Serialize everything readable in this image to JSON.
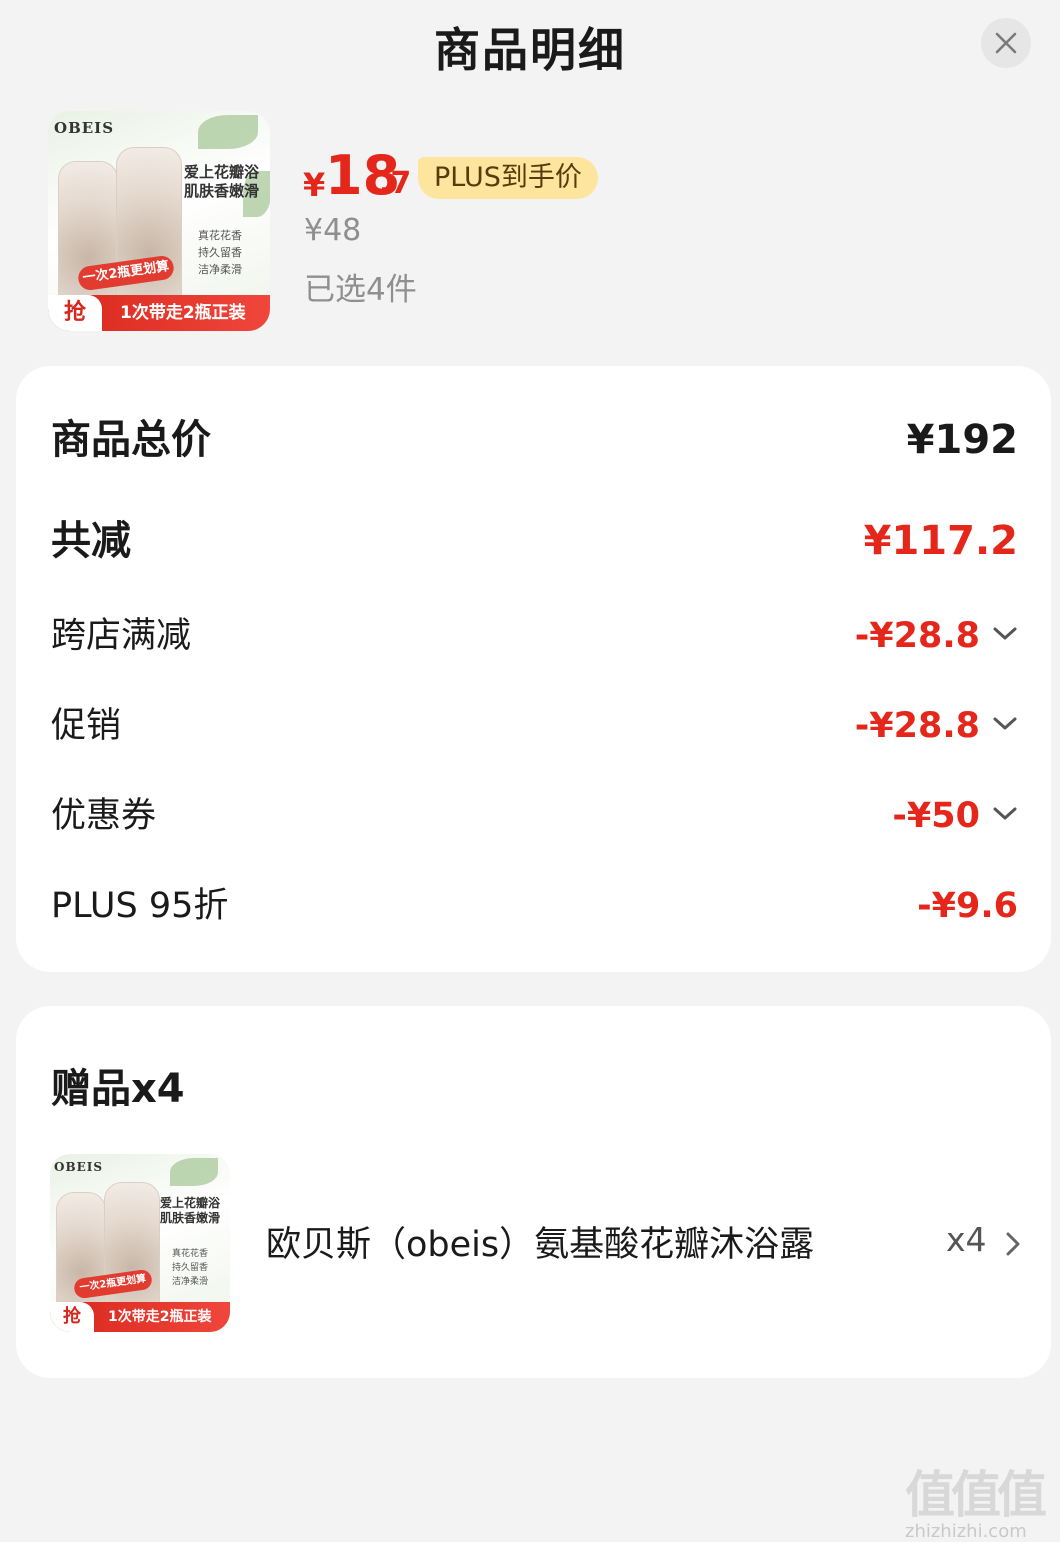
{
  "header": {
    "title": "商品明细"
  },
  "product": {
    "thumb": {
      "brand": "OBEIS",
      "headline_line1": "爱上花瓣浴",
      "headline_line2": "肌肤香嫩滑",
      "bullets": [
        "真花花香",
        "持久留香",
        "洁净柔滑"
      ],
      "ribbon": "一次2瓶更划算",
      "grab": "抢",
      "bar_text": "1次带走2瓶正装"
    },
    "price_currency": "¥",
    "price_int": "18",
    "price_dec": ".7",
    "plus_badge": "PLUS到手价",
    "original_price": "¥48",
    "selected": "已选4件"
  },
  "summary": {
    "total_label": "商品总价",
    "total_value": "¥192",
    "reduce_label": "共减",
    "reduce_value": "¥117.2",
    "items": [
      {
        "label": "跨店满减",
        "value": "-¥28.8",
        "expandable": true
      },
      {
        "label": "促销",
        "value": "-¥28.8",
        "expandable": true
      },
      {
        "label": "优惠券",
        "value": "-¥50",
        "expandable": true
      },
      {
        "label": "PLUS 95折",
        "value": "-¥9.6",
        "expandable": false
      }
    ]
  },
  "gifts": {
    "title": "赠品x4",
    "item_name": "欧贝斯（obeis）氨基酸花瓣沐浴露",
    "item_qty": "x4"
  },
  "watermark": {
    "logo": "值值值",
    "url": "zhizhizhi.com"
  },
  "colors": {
    "accent_red": "#e4271a",
    "plus_badge_bg": "#fde59d",
    "page_bg": "#f3f3f3"
  },
  "icons": {
    "close": "close-icon",
    "chevron_down": "chevron-down-icon",
    "chevron_right": "chevron-right-icon"
  }
}
